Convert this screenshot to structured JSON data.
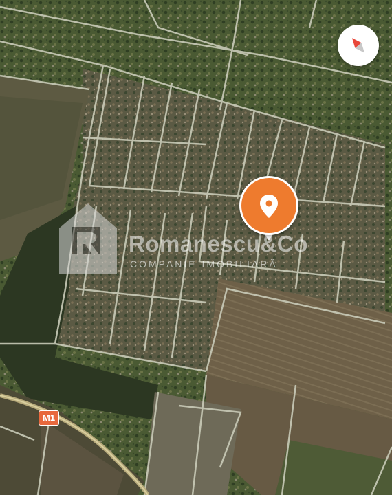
{
  "map": {
    "type": "satellite",
    "colors": {
      "vegetation_dark": "#2f3f26",
      "vegetation": "#4f6436",
      "field_brown": "#6c5e47",
      "field_tan": "#7d7254",
      "road": "#c9cbb8",
      "highway": "#b8ab7c"
    }
  },
  "compass": {
    "icon": "compass-icon"
  },
  "location_pin": {
    "icon": "location-pin-icon",
    "color": "#ee7b2e"
  },
  "watermark": {
    "name": "Romanescu&Co",
    "subtitle": "COMPANIE IMOBILIARĂ"
  },
  "road_badge": {
    "label": "M1",
    "color": "#e8683d"
  }
}
